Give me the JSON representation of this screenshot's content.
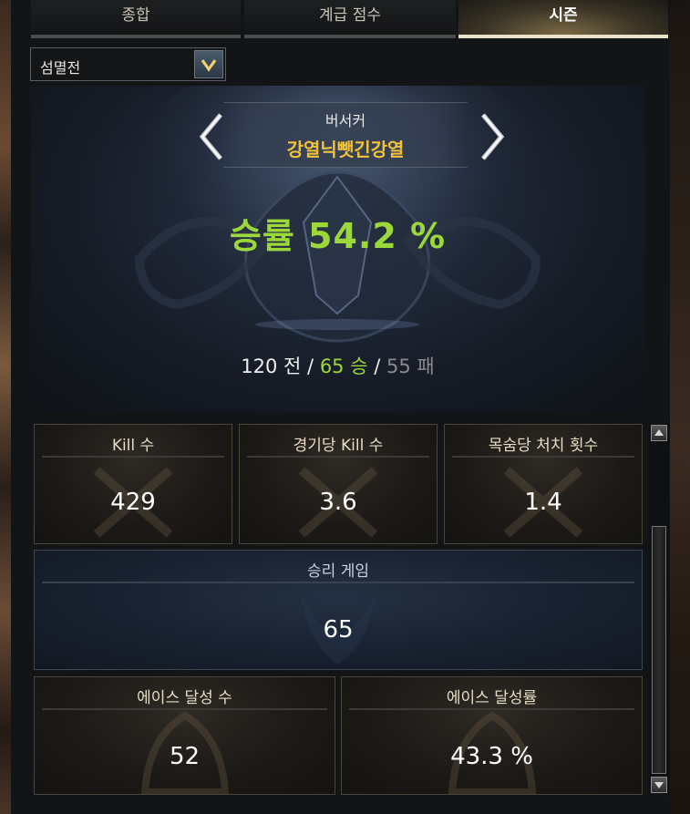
{
  "tabs": [
    {
      "label": "종합"
    },
    {
      "label": "계급 점수"
    },
    {
      "label": "시즌",
      "selected": true
    }
  ],
  "mode_select": {
    "value": "섬멸전"
  },
  "profile": {
    "class_name": "버서커",
    "character_name": "강열닉뺏긴강열",
    "win_rate_text": "승률 54.2 %",
    "record": {
      "total": "120 전",
      "wins": "65 승",
      "losses": "55 패",
      "separator": "/"
    }
  },
  "stats": {
    "kills": {
      "label": "Kill 수",
      "value": "429"
    },
    "kills_per_game": {
      "label": "경기당 Kill 수",
      "value": "3.6"
    },
    "kills_per_life": {
      "label": "목숨당 처치 횟수",
      "value": "1.4"
    },
    "games_won": {
      "label": "승리 게임",
      "value": "65"
    },
    "ace_count": {
      "label": "에이스 달성 수",
      "value": "52"
    },
    "ace_rate": {
      "label": "에이스 달성률",
      "value": "43.3 %"
    }
  },
  "colors": {
    "accent_green": "#9bd83a",
    "name_gold": "#f2c23a",
    "loss_gray": "#8a8a8a"
  }
}
